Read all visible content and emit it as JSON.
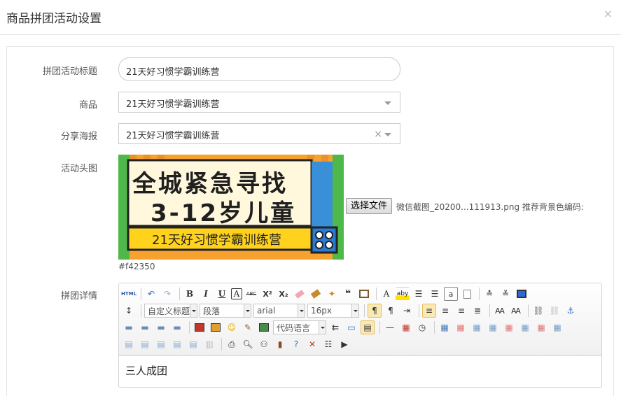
{
  "header": {
    "title": "商品拼团活动设置",
    "close_label": "×"
  },
  "form": {
    "activity_title": {
      "label": "拼团活动标题",
      "value": "21天好习惯学霸训练营"
    },
    "product": {
      "label": "商品",
      "value": "21天好习惯学霸训练营"
    },
    "poster": {
      "label": "分享海报",
      "value": "21天好习惯学霸训练营",
      "clear_label": "×"
    },
    "head_image": {
      "label": "活动头图",
      "poster_line1": "全城紧急寻找",
      "poster_line2": "3-12岁儿童",
      "poster_line3": "21天好习惯学霸训练营",
      "file_button": "选择文件",
      "file_name": "微信截图_20200...111913.png",
      "color_hint": "推荐背景色编码:",
      "color_code": "#f42350",
      "colors": {
        "poster_bg": "#f7a12e",
        "banner": "#ffd21e",
        "headline_bg": "#fff8dc"
      }
    },
    "details": {
      "label": "拼团详情",
      "content": "三人成团",
      "toolbar": {
        "html_label": "HTML",
        "bold": "B",
        "italic": "I",
        "underline": "U",
        "border": "A",
        "strike": "ABC",
        "superscript": "X²",
        "subscript": "X₂",
        "quote": "❝",
        "font_color": "A",
        "highlight": "aby",
        "custom_title": "自定义标题",
        "paragraph": "段落",
        "font_family": "arial",
        "font_size": "16px",
        "code_lang": "代码语言"
      }
    }
  }
}
